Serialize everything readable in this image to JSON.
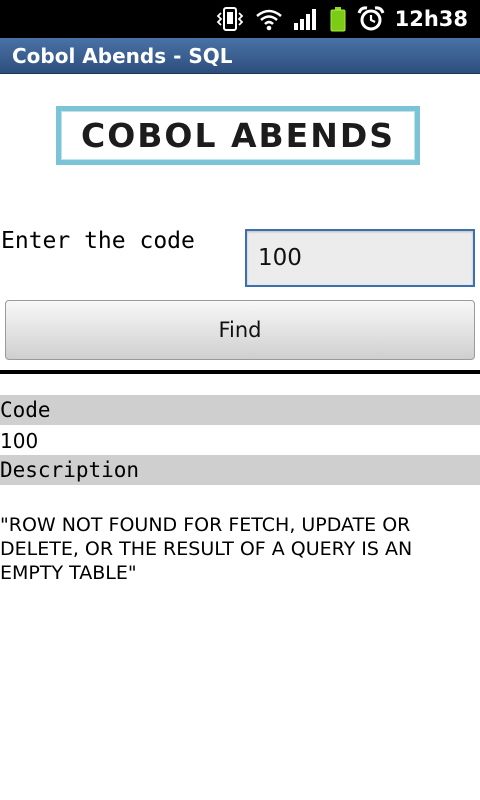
{
  "status_bar": {
    "time": "12h38",
    "icons": [
      "vibrate-icon",
      "wifi-icon",
      "signal-icon",
      "battery-icon",
      "alarm-icon"
    ]
  },
  "app": {
    "title": "Cobol Abends - SQL",
    "logo_text": "COBOL ABENDS"
  },
  "form": {
    "label": "Enter the code",
    "code_value": "100",
    "find_label": "Find"
  },
  "result": {
    "code_header": "Code",
    "code_value": "100",
    "description_header": "Description",
    "description_value": "\"ROW NOT FOUND FOR FETCH, UPDATE OR DELETE, OR THE RESULT OF  A QUERY IS AN EMPTY TABLE\""
  },
  "colors": {
    "titlebar": "#3b6194",
    "logo_border": "#7bc4d8",
    "input_border": "#3a6fb0",
    "row_header_bg": "#cfcfcf"
  }
}
